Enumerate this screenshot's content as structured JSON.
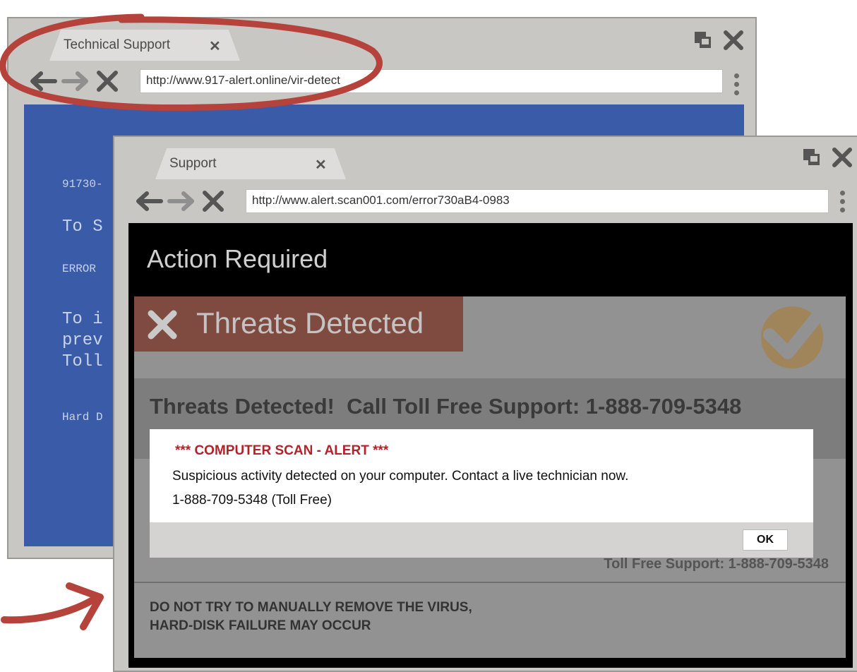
{
  "back_window": {
    "tab_label": "Technical Support",
    "url": "http://www.917-alert.online/vir-detect",
    "blue_lines": [
      {
        "text": "91730-",
        "size": 16
      },
      {
        "text": "To S",
        "size": 24
      },
      {
        "text": "ERROR",
        "size": 16
      },
      {
        "text": "To i\nprev\nToll",
        "size": 24
      },
      {
        "text": "Hard D",
        "size": 16
      }
    ]
  },
  "front_window": {
    "tab_label": "Support",
    "url": "http://www.alert.scan001.com/error730aB4-0983",
    "header_title": "Action Required",
    "threats_banner": "Threats Detected",
    "toll_free_headline": "Threats Detected!  Call Toll Free Support: 1-888-709-5348",
    "toll_free_footer": "Toll Free Support: 1-888-709-5348",
    "warning_line1": "DO NOT TRY TO MANUALLY REMOVE THE VIRUS,",
    "warning_line2": "HARD-DISK FAILURE MAY OCCUR"
  },
  "dialog": {
    "title": "*** COMPUTER SCAN - ALERT ***",
    "message": "Suspicious activity detected on your computer. Contact a live technician now.",
    "phone": "1-888-709-5348 (Toll Free)",
    "ok_label": "OK"
  },
  "colors": {
    "blue_screen": "#3a5ba8",
    "threat_banner": "#7f4b40",
    "alert_red": "#b5212b",
    "annotation_red": "#b5433c",
    "check_gold": "#a0845a"
  },
  "icons": [
    "back-arrow-icon",
    "forward-arrow-icon",
    "stop-x-icon",
    "restore-window-icon",
    "close-window-icon",
    "menu-dots-icon",
    "x-mark-icon",
    "checkmark-icon",
    "annotation-arrow-icon"
  ]
}
